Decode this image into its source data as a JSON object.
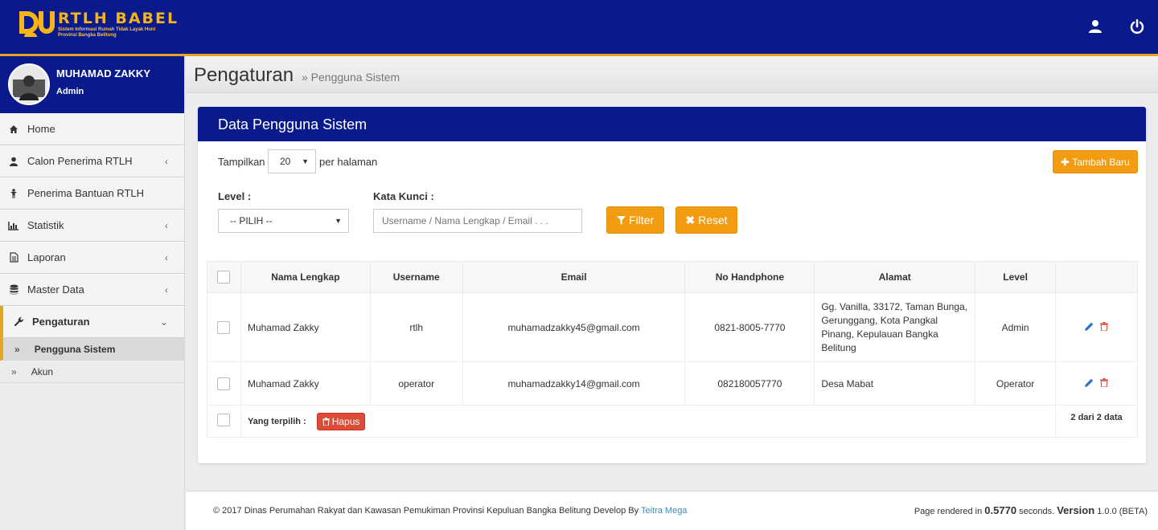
{
  "app": {
    "logo_title": "RTLH BABEL",
    "logo_sub1": "Sistem Informasi Rumah Tidak Layak Huni",
    "logo_sub2": "Provinsi Bangka Belitung",
    "accent": "#e8a321",
    "brand": "#0a1a8c"
  },
  "topbar": {
    "icons": [
      "user-icon",
      "power-icon"
    ]
  },
  "user": {
    "name": "MUHAMAD ZAKKY",
    "role": "Admin"
  },
  "sidebar": {
    "items": [
      {
        "label": "Home",
        "icon": "home-icon"
      },
      {
        "label": "Calon Penerima RTLH",
        "icon": "user-icon",
        "chevron": "‹"
      },
      {
        "label": "Penerima Bantuan RTLH",
        "icon": "person-icon"
      },
      {
        "label": "Statistik",
        "icon": "bar-chart-icon",
        "chevron": "‹"
      },
      {
        "label": "Laporan",
        "icon": "document-icon",
        "chevron": "‹"
      },
      {
        "label": "Master Data",
        "icon": "database-icon",
        "chevron": "‹"
      },
      {
        "label": "Pengaturan",
        "icon": "wrench-icon",
        "chevron": "⌄"
      }
    ],
    "sub_items": [
      {
        "label": "Pengguna Sistem",
        "marker": "»"
      },
      {
        "label": "Akun",
        "marker": "»"
      }
    ]
  },
  "header": {
    "title": "Pengaturan",
    "subtitle": "» Pengguna Sistem"
  },
  "box": {
    "title": "Data Pengguna Sistem",
    "show_label": "Tampilkan",
    "page_size": "20",
    "per_page_label": "per halaman",
    "add_button": "Tambah Baru",
    "level_label": "Level :",
    "level_value": "-- PILIH --",
    "keyword_label": "Kata Kunci :",
    "keyword_placeholder": "Username / Nama Lengkap / Email . . .",
    "filter_button": "Filter",
    "reset_button": "Reset"
  },
  "table": {
    "columns": [
      "Nama Lengkap",
      "Username",
      "Email",
      "No Handphone",
      "Alamat",
      "Level"
    ],
    "rows": [
      {
        "nama": "Muhamad Zakky",
        "username": "rtlh",
        "email": "muhamadzakky45@gmail.com",
        "hp": "0821-8005-7770",
        "alamat": "Gg. Vanilla, 33172, Taman Bunga, Gerunggang, Kota Pangkal Pinang, Kepulauan Bangka Belitung",
        "level": "Admin"
      },
      {
        "nama": "Muhamad Zakky",
        "username": "operator",
        "email": "muhamadzakky14@gmail.com",
        "hp": "082180057770",
        "alamat": "Desa Mabat",
        "level": "Operator"
      }
    ],
    "selected_label": "Yang terpilih :",
    "delete_button": "Hapus",
    "count_text": "2 dari 2 data"
  },
  "footer": {
    "copyright": "© 2017 Dinas Perumahan Rakyat dan Kawasan Pemukiman Provinsi Kepuluan Bangka Belitung Develop By",
    "developer": "Teitra Mega",
    "rendered_prefix": "Page rendered in",
    "rendered_time": "0.5770",
    "rendered_suffix": "seconds.",
    "version_label": "Version",
    "version_value": "1.0.0 (BETA)"
  }
}
